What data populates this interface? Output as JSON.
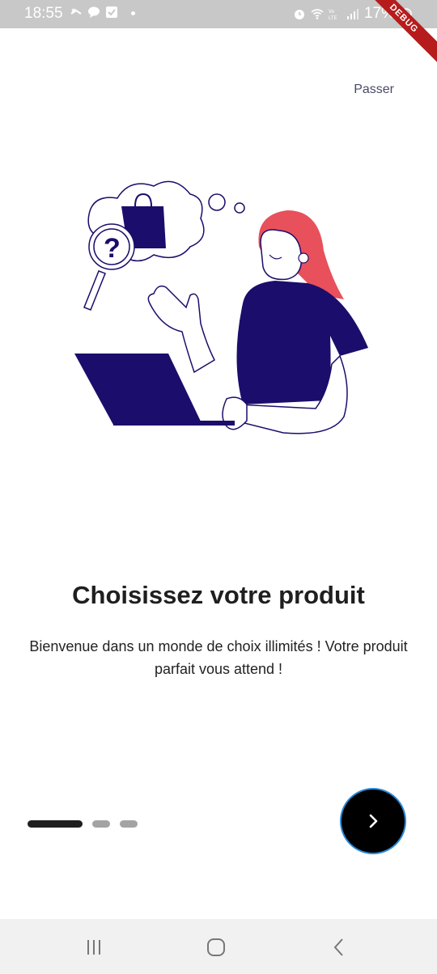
{
  "status_bar": {
    "time": "18:55",
    "battery": "17%",
    "debug_label": "DEBUG",
    "icons": [
      "missed-call-icon",
      "chat-bubble-icon",
      "checkbox-icon",
      "dot-icon",
      "alarm-icon",
      "wifi-icon",
      "volte-icon",
      "signal-icon",
      "battery-icon"
    ]
  },
  "skip_label": "Passer",
  "illustration": "person-shopping-laptop-illustration",
  "title": "Choisissez votre produit",
  "subtitle": "Bienvenue dans un monde de choix illimités ! Votre produit parfait vous attend !",
  "page_indicator": {
    "current": 1,
    "total": 3
  },
  "next_button_icon": "chevron-right-icon",
  "nav_bar": {
    "buttons": [
      "recent-apps-icon",
      "home-icon",
      "back-icon"
    ]
  },
  "colors": {
    "accent": "#1b0d6b",
    "hair": "#e8505b",
    "button": "#000000",
    "button_border": "#2a88d8"
  }
}
